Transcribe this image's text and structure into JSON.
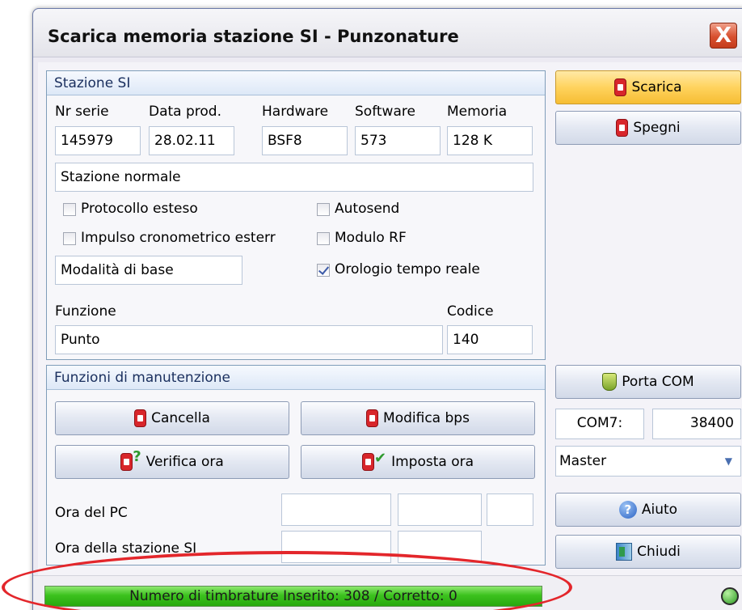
{
  "window": {
    "title": "Scarica memoria stazione SI - Punzonature",
    "close_label": "X"
  },
  "stazione": {
    "header": "Stazione SI",
    "labels": {
      "nr_serie": "Nr serie",
      "data_prod": "Data prod.",
      "hardware": "Hardware",
      "software": "Software",
      "memoria": "Memoria"
    },
    "values": {
      "nr_serie": "145979",
      "data_prod": "28.02.11",
      "hardware": "BSF8",
      "software": "573",
      "memoria": "128 K"
    },
    "tipo": "Stazione normale",
    "checkboxes": [
      {
        "label": "Protocollo esteso",
        "checked": false
      },
      {
        "label": "Impulso cronometrico esterr",
        "checked": false
      },
      {
        "label": "Autosend",
        "checked": false
      },
      {
        "label": "Modulo RF",
        "checked": false
      },
      {
        "label": "Orologio tempo reale",
        "checked": true
      }
    ],
    "modalita": "Modalità di base",
    "funzione_label": "Funzione",
    "funzione_value": "Punto",
    "codice_label": "Codice",
    "codice_value": "140"
  },
  "manutenzione": {
    "header": "Funzioni di manutenzione",
    "cancella": "Cancella",
    "modifica_bps": "Modifica bps",
    "verifica_ora": "Verifica ora",
    "imposta_ora": "Imposta ora",
    "ora_pc_label": "Ora del PC",
    "ora_stazione_label": "Ora della stazione SI"
  },
  "side": {
    "scarica": "Scarica",
    "spegni": "Spegni",
    "porta_com": "Porta COM",
    "com_port": "COM7:",
    "baud": "38400",
    "mode": "Master",
    "aiuto": "Aiuto",
    "chiudi": "Chiudi"
  },
  "status": {
    "text": "Numero di timbrature Inserito: 308 / Corretto: 0"
  },
  "colors": {
    "annotation": "#e3262b",
    "progress": "#3cc21e",
    "primary": "#ffd35e"
  }
}
